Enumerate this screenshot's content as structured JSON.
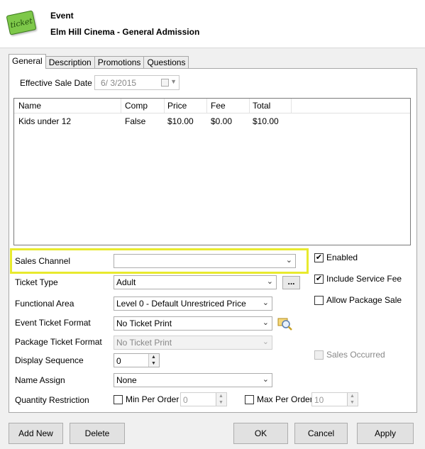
{
  "header": {
    "icon_text": "ticket",
    "title": "Event",
    "subtitle": "Elm Hill Cinema - General Admission"
  },
  "tabs": [
    {
      "label": "General",
      "active": true
    },
    {
      "label": "Description"
    },
    {
      "label": "Promotions"
    },
    {
      "label": "Questions"
    }
  ],
  "effective_sale_date": {
    "label": "Effective Sale Date",
    "value": "6/  3/2015"
  },
  "grid": {
    "columns": [
      "Name",
      "Comp",
      "Price",
      "Fee",
      "Total"
    ],
    "rows": [
      [
        "Kids under 12",
        "False",
        "$10.00",
        "$0.00",
        "$10.00"
      ]
    ]
  },
  "form": {
    "sales_channel": {
      "label": "Sales Channel",
      "value": ""
    },
    "ticket_type": {
      "label": "Ticket Type",
      "value": "Adult",
      "browse": "..."
    },
    "functional_area": {
      "label": "Functional Area",
      "value": "Level 0 - Default Unrestriced Price"
    },
    "event_ticket_format": {
      "label": "Event Ticket Format",
      "value": "No Ticket Print"
    },
    "package_ticket_format": {
      "label": "Package Ticket Format",
      "value": "No Ticket Print"
    },
    "display_sequence": {
      "label": "Display Sequence",
      "value": "0"
    },
    "name_assign": {
      "label": "Name Assign",
      "value": "None"
    },
    "quantity_restriction": {
      "label": "Quantity Restriction",
      "min_label": "Min Per Order",
      "min_value": "0",
      "max_label": "Max Per Order",
      "max_value": "10"
    }
  },
  "options": {
    "enabled": {
      "label": "Enabled",
      "checked": true
    },
    "include_service_fee": {
      "label": "Include Service Fee",
      "checked": true
    },
    "allow_package_sale": {
      "label": "Allow Package Sale",
      "checked": false
    },
    "sales_occurred": {
      "label": "Sales Occurred",
      "checked": false
    }
  },
  "buttons": {
    "add_new": "Add New",
    "delete": "Delete",
    "ok": "OK",
    "cancel": "Cancel",
    "apply": "Apply"
  },
  "colors": {
    "highlight": "#e8ea2e",
    "ticket_icon": "#7ec84a"
  }
}
